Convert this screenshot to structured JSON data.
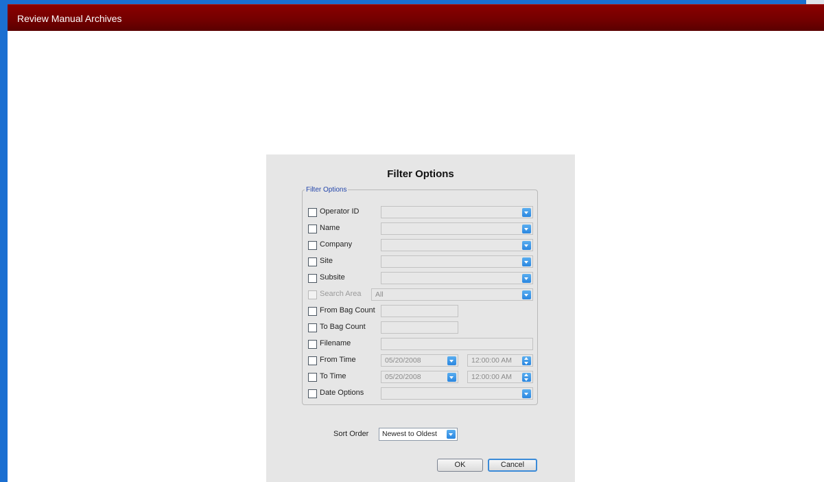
{
  "window": {
    "title": "Review Manual Archives"
  },
  "dialog": {
    "title": "Filter Options",
    "group_label": "Filter Options",
    "rows": {
      "operator_id": {
        "label": "Operator ID",
        "value": ""
      },
      "name": {
        "label": "Name",
        "value": ""
      },
      "company": {
        "label": "Company",
        "value": ""
      },
      "site": {
        "label": "Site",
        "value": ""
      },
      "subsite": {
        "label": "Subsite",
        "value": ""
      },
      "search_area": {
        "label": "Search Area",
        "value": "All"
      },
      "from_bag_count": {
        "label": "From Bag Count",
        "value": ""
      },
      "to_bag_count": {
        "label": "To Bag Count",
        "value": ""
      },
      "filename": {
        "label": "Filename",
        "value": ""
      },
      "from_time": {
        "label": "From Time",
        "date": "05/20/2008",
        "time": "12:00:00 AM"
      },
      "to_time": {
        "label": "To Time",
        "date": "05/20/2008",
        "time": "12:00:00 AM"
      },
      "date_options": {
        "label": "Date Options",
        "value": ""
      }
    },
    "sort": {
      "label": "Sort Order",
      "value": "Newest to Oldest"
    },
    "buttons": {
      "ok": "OK",
      "cancel": "Cancel"
    }
  },
  "icons": {
    "dropdown": "chevron-down-icon",
    "spinner": "spin-updown-icon"
  },
  "colors": {
    "titlebar": "#7a0000",
    "window_border": "#1b6fd1",
    "dialog_bg": "#e6e6e6",
    "control_accent": "#3a8ee6"
  }
}
